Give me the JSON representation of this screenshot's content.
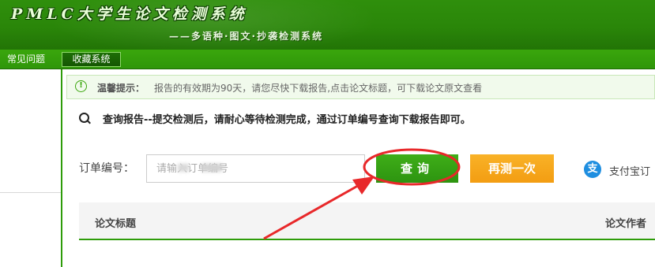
{
  "header": {
    "title": "PMLC大学生论文检测系统",
    "subtitle": "——多语种·图文·抄袭检测系统"
  },
  "nav": {
    "items": [
      "常见问题",
      "收藏系统"
    ]
  },
  "notice": {
    "icon": "info-circle-icon",
    "label": "温馨提示：",
    "text": "报告的有效期为90天，请您尽快下载报告,点击论文标题，可下载论文原文查看"
  },
  "query_info": {
    "icon": "search-icon",
    "text": "查询报告--提交检测后，请耐心等待检测完成，通过订单编号查询下载报告即可。"
  },
  "order_form": {
    "label": "订单编号：",
    "placeholder": "请输入订单编号",
    "query_button": "查询",
    "retest_button": "再测一次",
    "alipay_icon": "alipay-icon",
    "alipay_label": "支付宝订"
  },
  "table": {
    "columns": [
      "论文标题",
      "论文作者"
    ]
  },
  "colors": {
    "brand_green": "#2e9c0a",
    "query_button": "#3aa314",
    "retest_button": "#f5a519",
    "annotation_red": "#e8282a"
  }
}
